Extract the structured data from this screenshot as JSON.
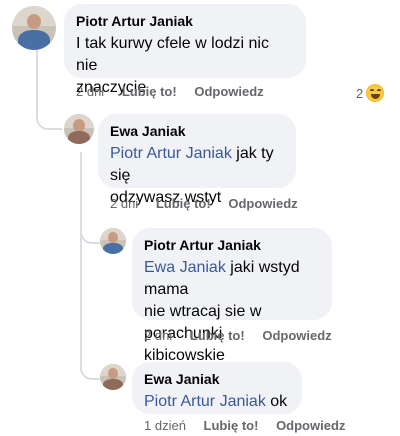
{
  "thread": {
    "comments": [
      {
        "author": "Piotr Artur Janiak",
        "text_line1": "I tak kurwy cfele w lodzi nic nie",
        "text_line2": "znaczycie",
        "time": "2 dni",
        "like": "Lubię to!",
        "reply": "Odpowiedz",
        "reaction_count": "2",
        "reaction_icon": "haha-emoji-icon"
      },
      {
        "author": "Ewa Janiak",
        "mention": "Piotr Artur Janiak",
        "text_rest1": " jak ty się",
        "text_line2": "odzywasz wstyt",
        "time": "2 dni",
        "like": "Lubię to!",
        "reply": "Odpowiedz"
      },
      {
        "author": "Piotr Artur Janiak",
        "mention": "Ewa Janiak",
        "text_rest1": " jaki wstyd mama",
        "text_line2": "nie wtracaj sie w porachunki",
        "text_line3": "kibicowskie",
        "time": "2 dni",
        "like": "Lubię to!",
        "reply": "Odpowiedz"
      },
      {
        "author": "Ewa Janiak",
        "mention": "Piotr Artur Janiak",
        "text_rest1": " ok",
        "time": "1 dzień",
        "like": "Lubię to!",
        "reply": "Odpowiedz"
      }
    ]
  },
  "colors": {
    "bubble": "#f0f2f5",
    "mention": "#3b5998",
    "meta": "#65676b",
    "thread_line": "#dadde1"
  }
}
